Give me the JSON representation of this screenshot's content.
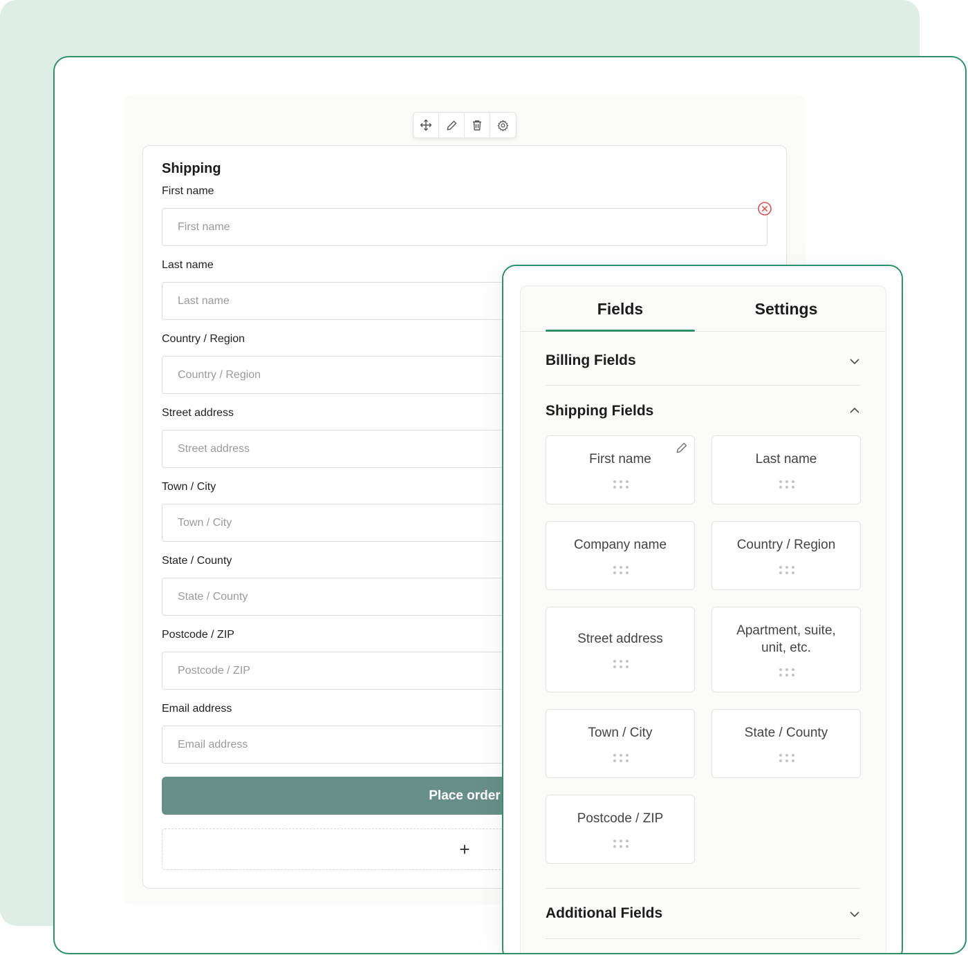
{
  "form": {
    "title": "Shipping",
    "fields": [
      {
        "label": "First name",
        "placeholder": "First name"
      },
      {
        "label": "Last name",
        "placeholder": "Last name"
      },
      {
        "label": "Country / Region",
        "placeholder": "Country / Region"
      },
      {
        "label": "Street address",
        "placeholder": "Street address"
      },
      {
        "label": "Town / City",
        "placeholder": "Town / City"
      },
      {
        "label": "State / County",
        "placeholder": "State / County"
      },
      {
        "label": "Postcode / ZIP",
        "placeholder": "Postcode / ZIP"
      },
      {
        "label": "Email address",
        "placeholder": "Email address"
      }
    ],
    "place_order_label": "Place order",
    "add_block_symbol": "+"
  },
  "toolbar": {
    "icons": [
      "move-icon",
      "pencil-icon",
      "trash-icon",
      "gear-icon"
    ]
  },
  "panel": {
    "tabs": [
      {
        "label": "Fields",
        "active": true
      },
      {
        "label": "Settings",
        "active": false
      }
    ],
    "sections": [
      {
        "title": "Billing Fields",
        "expanded": false
      },
      {
        "title": "Shipping Fields",
        "expanded": true
      },
      {
        "title": "Additional Fields",
        "expanded": false
      }
    ],
    "shipping_tiles": [
      {
        "label": "First name"
      },
      {
        "label": "Last name"
      },
      {
        "label": "Company name"
      },
      {
        "label": "Country / Region"
      },
      {
        "label": "Street address"
      },
      {
        "label": "Apartment, suite, unit, etc."
      },
      {
        "label": "Town / City"
      },
      {
        "label": "State / County"
      },
      {
        "label": "Postcode / ZIP"
      }
    ]
  },
  "colors": {
    "accent": "#2f8f69",
    "background_card": "#deede6",
    "button": "#688f87",
    "remove": "#d9534f"
  }
}
